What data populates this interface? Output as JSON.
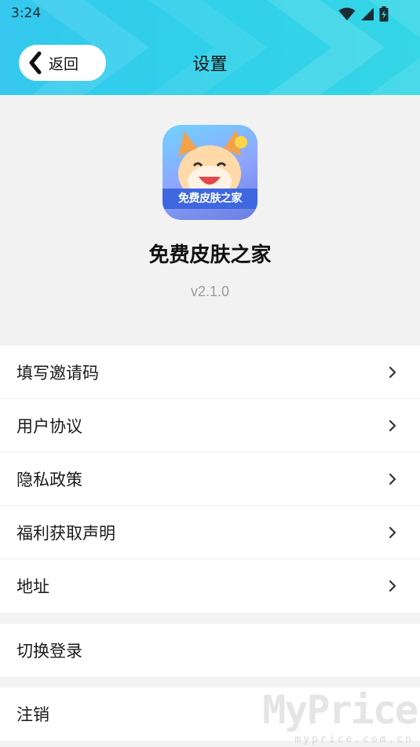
{
  "status_bar": {
    "time": "3:24",
    "icons": [
      "wifi-icon",
      "signal-icon",
      "battery-charging-icon"
    ]
  },
  "header": {
    "back_label": "返回",
    "title": "设置",
    "accent_color": "#36c8ee"
  },
  "app": {
    "icon_text": "免费皮肤之家",
    "name": "免费皮肤之家",
    "version": "v2.1.0"
  },
  "menu": {
    "items": [
      {
        "label": "填写邀请码"
      },
      {
        "label": "用户协议"
      },
      {
        "label": "隐私政策"
      },
      {
        "label": "福利获取声明"
      },
      {
        "label": "地址"
      }
    ],
    "switch_login": "切换登录",
    "logout": "注销"
  },
  "watermark": {
    "main": "MyPrice",
    "sub": "myprice.com.cn"
  }
}
